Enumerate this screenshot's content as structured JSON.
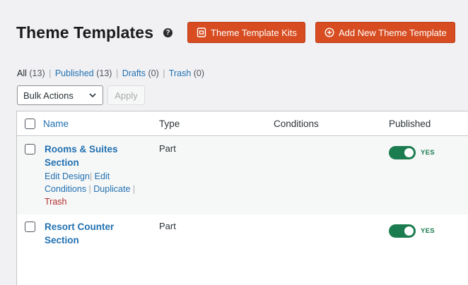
{
  "header": {
    "title": "Theme Templates",
    "help_icon": "?",
    "kits_button": "Theme Template Kits",
    "add_button": "Add New Theme Template"
  },
  "filters": {
    "all_label": "All",
    "all_count": "(13)",
    "published_label": "Published",
    "published_count": "(13)",
    "drafts_label": "Drafts",
    "drafts_count": "(0)",
    "trash_label": "Trash",
    "trash_count": "(0)"
  },
  "bulk": {
    "selected": "Bulk Actions",
    "apply_label": "Apply"
  },
  "table": {
    "columns": {
      "name": "Name",
      "type": "Type",
      "conditions": "Conditions",
      "published": "Published"
    },
    "rows": [
      {
        "title": "Rooms & Suites Section",
        "type": "Part",
        "published": "YES",
        "actions": {
          "edit_design": "Edit Design",
          "edit_conditions": "Edit Conditions",
          "duplicate": "Duplicate",
          "trash": "Trash"
        }
      },
      {
        "title": "Resort Counter Section",
        "type": "Part",
        "published": "YES"
      }
    ]
  },
  "colors": {
    "accent_orange": "#d74d21",
    "link_blue": "#2271b1",
    "toggle_green": "#1b7d4f",
    "trash_red": "#b32d2e"
  }
}
